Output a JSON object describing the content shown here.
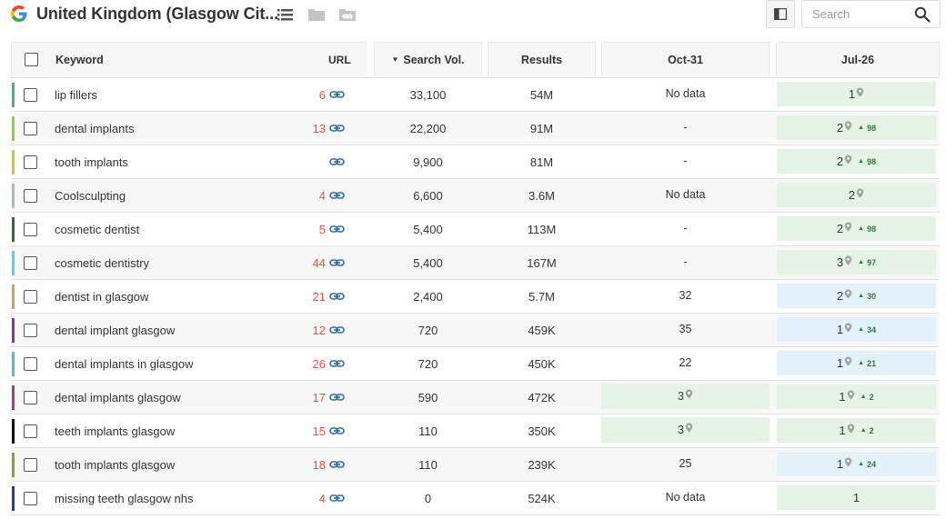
{
  "header": {
    "title": "United Kingdom (Glasgow Cit...",
    "search_placeholder": "Search",
    "icons": [
      "google-icon",
      "list-icon",
      "folder-icon",
      "folder-link-icon",
      "columns-icon",
      "search-icon"
    ]
  },
  "table": {
    "columns": {
      "keyword": "Keyword",
      "url": "URL",
      "volume": "Search Vol.",
      "results": "Results",
      "date1": "Oct-31",
      "date2": "Jul-26"
    },
    "rows": [
      {
        "keyword": "lip fillers",
        "url_rank": "6",
        "volume": "33,100",
        "results": "54M",
        "date1": "No data",
        "date1_pin": false,
        "date2_rank": "1",
        "date2_pin": true,
        "change": "",
        "color": "#4caf8f",
        "date2_style": "green"
      },
      {
        "keyword": "dental implants",
        "url_rank": "13",
        "volume": "22,200",
        "results": "91M",
        "date1": "-",
        "date1_pin": false,
        "date2_rank": "2",
        "date2_pin": true,
        "change": "98",
        "color": "#8bd43f",
        "date2_style": "green"
      },
      {
        "keyword": "tooth implants",
        "url_rank": "",
        "volume": "9,900",
        "results": "81M",
        "date1": "-",
        "date1_pin": false,
        "date2_rank": "2",
        "date2_pin": true,
        "change": "98",
        "color": "#c5c92a",
        "date2_style": "green"
      },
      {
        "keyword": "Coolsculpting",
        "url_rank": "4",
        "volume": "6,600",
        "results": "3.6M",
        "date1": "No data",
        "date1_pin": false,
        "date2_rank": "2",
        "date2_pin": true,
        "change": "",
        "color": "#9ec4b8",
        "date2_style": "green"
      },
      {
        "keyword": "cosmetic dentist",
        "url_rank": "5",
        "volume": "5,400",
        "results": "113M",
        "date1": "-",
        "date1_pin": false,
        "date2_rank": "2",
        "date2_pin": true,
        "change": "98",
        "color": "#2e6b2e",
        "date2_style": "green"
      },
      {
        "keyword": "cosmetic dentistry",
        "url_rank": "44",
        "volume": "5,400",
        "results": "167M",
        "date1": "-",
        "date1_pin": false,
        "date2_rank": "3",
        "date2_pin": true,
        "change": "97",
        "color": "#4fd3e6",
        "date2_style": "green"
      },
      {
        "keyword": "dentist in glasgow",
        "url_rank": "21",
        "volume": "2,400",
        "results": "5.7M",
        "date1": "32",
        "date1_pin": false,
        "date2_rank": "2",
        "date2_pin": true,
        "change": "30",
        "color": "#c9a06b",
        "date2_style": "blue"
      },
      {
        "keyword": "dental implant glasgow",
        "url_rank": "12",
        "volume": "720",
        "results": "459K",
        "date1": "35",
        "date1_pin": false,
        "date2_rank": "1",
        "date2_pin": true,
        "change": "34",
        "color": "#7a3a9e",
        "date2_style": "blue"
      },
      {
        "keyword": "dental implants in glasgow",
        "url_rank": "26",
        "volume": "720",
        "results": "450K",
        "date1": "22",
        "date1_pin": false,
        "date2_rank": "1",
        "date2_pin": true,
        "change": "21",
        "color": "#5ab9d6",
        "date2_style": "blue"
      },
      {
        "keyword": "dental implants glasgow",
        "url_rank": "17",
        "volume": "590",
        "results": "472K",
        "date1": "3",
        "date1_pin": true,
        "date2_rank": "1",
        "date2_pin": true,
        "change": "2",
        "color": "#a83a7a",
        "date2_style": "green"
      },
      {
        "keyword": "teeth implants glasgow",
        "url_rank": "15",
        "volume": "110",
        "results": "350K",
        "date1": "3",
        "date1_pin": true,
        "date2_rank": "1",
        "date2_pin": true,
        "change": "2",
        "color": "#111111",
        "date2_style": "green"
      },
      {
        "keyword": "tooth implants glasgow",
        "url_rank": "18",
        "volume": "110",
        "results": "239K",
        "date1": "25",
        "date1_pin": false,
        "date2_rank": "1",
        "date2_pin": true,
        "change": "24",
        "color": "#8a9e3a",
        "date2_style": "blue"
      },
      {
        "keyword": "missing teeth glasgow nhs",
        "url_rank": "4",
        "volume": "0",
        "results": "524K",
        "date1": "No data",
        "date1_pin": false,
        "date2_rank": "1",
        "date2_pin": false,
        "change": "",
        "color": "#2b3a9e",
        "date2_style": "green"
      }
    ]
  },
  "colors": {
    "rank_red": "#e5534b",
    "link_blue": "#2b6cb0",
    "pin_gray": "#a0a0a0",
    "change_green": "#2e7d32",
    "cell_green": "#e4f3e6",
    "cell_blue": "#e3f1fb"
  }
}
